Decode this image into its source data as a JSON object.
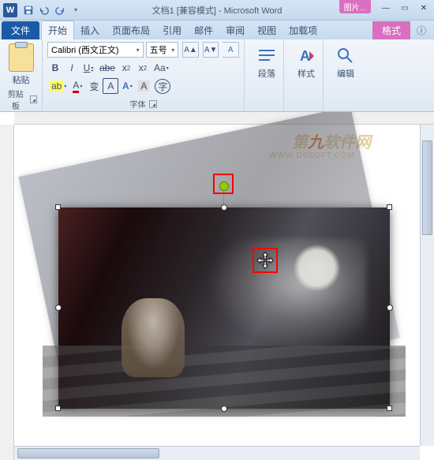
{
  "titlebar": {
    "word_icon": "W",
    "title": "文档1 [兼容模式] - Microsoft Word",
    "pic_tools_badge": "图片...",
    "win": {
      "min": "—",
      "max": "▭",
      "close": "✕"
    }
  },
  "tabs": {
    "file": "文件",
    "home": "开始",
    "insert": "插入",
    "layout": "页面布局",
    "references": "引用",
    "mailings": "邮件",
    "review": "审阅",
    "view": "视图",
    "addins": "加载项",
    "format": "格式",
    "help": "ⓘ"
  },
  "ribbon": {
    "clipboard": {
      "paste": "粘贴",
      "label": "剪贴板"
    },
    "font": {
      "name": "Calibri (西文正文)",
      "size": "五号",
      "bold": "B",
      "italic": "I",
      "underline": "U",
      "strike": "abe",
      "subscript": "x₂",
      "superscript": "x²",
      "clear": "Aa",
      "highlight": "ab",
      "fontcolor": "A",
      "phonetic": "变",
      "border": "A",
      "bigA": "A",
      "shrinkA": "A",
      "label": "字体"
    },
    "paragraph": {
      "label": "段落"
    },
    "styles": {
      "label": "样式"
    },
    "editing": {
      "label": "编辑"
    }
  },
  "watermark": {
    "text_pre": "第",
    "text_hl": "九",
    "text_post": "软件网",
    "url": "WWW.D9SOFT.COM"
  },
  "icons": {
    "save": "save-icon",
    "undo": "undo-icon",
    "redo": "redo-icon"
  }
}
